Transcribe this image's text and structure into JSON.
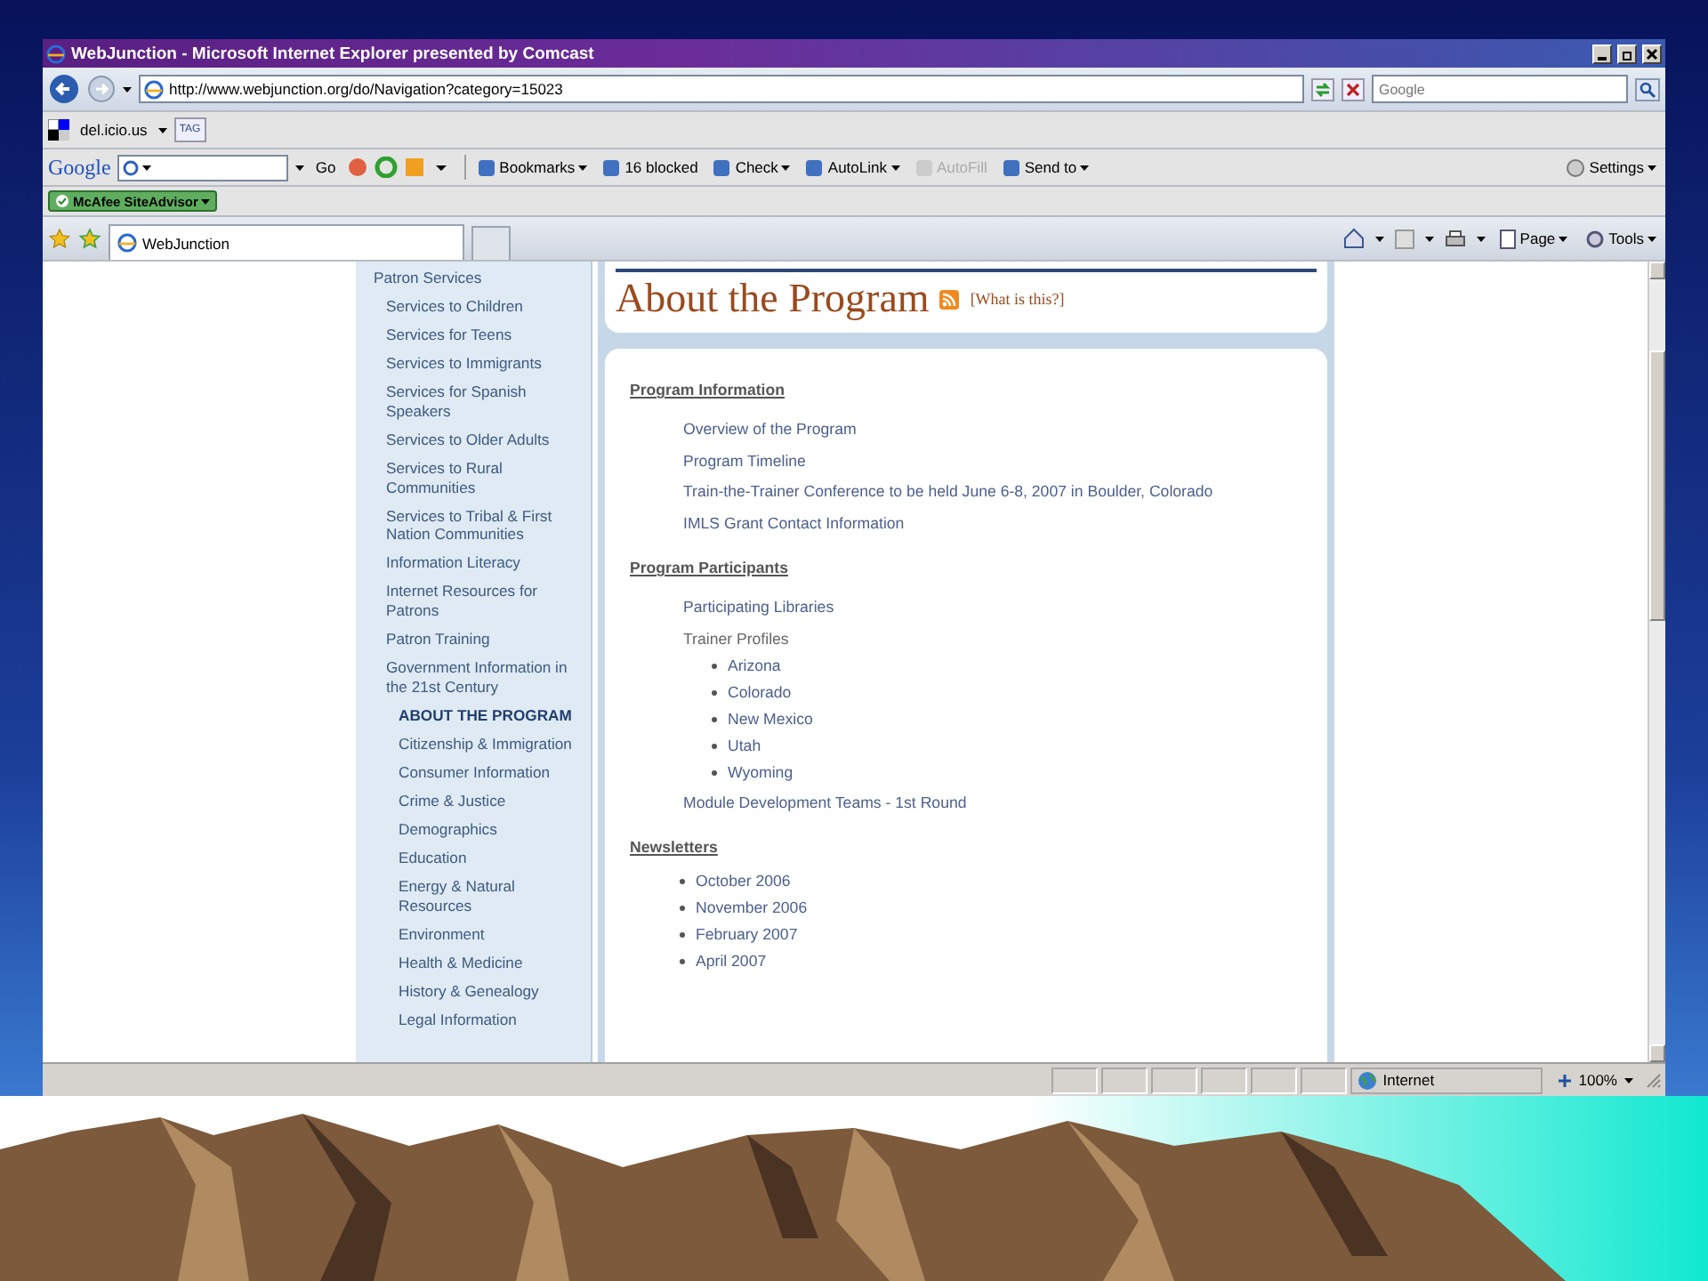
{
  "window": {
    "title": "WebJunction - Microsoft Internet Explorer presented by Comcast"
  },
  "address_bar": {
    "url": "http://www.webjunction.org/do/Navigation?category=15023",
    "search_placeholder": "Google"
  },
  "links_toolbar": {
    "link": "del.icio.us",
    "tag": "TAG"
  },
  "google_toolbar": {
    "logo": "Google",
    "go": "Go",
    "items": [
      {
        "label": "Bookmarks",
        "menu": true,
        "disabled": false
      },
      {
        "label": "16 blocked",
        "menu": false,
        "disabled": false
      },
      {
        "label": "Check",
        "menu": true,
        "disabled": false
      },
      {
        "label": "AutoLink",
        "menu": true,
        "disabled": false
      },
      {
        "label": "AutoFill",
        "menu": false,
        "disabled": true
      },
      {
        "label": "Send to",
        "menu": true,
        "disabled": false
      }
    ],
    "settings": "Settings"
  },
  "siteadvisor": {
    "label": "McAfee SiteAdvisor"
  },
  "tabs": [
    {
      "label": "WebJunction",
      "selected": true
    }
  ],
  "command_bar": {
    "page": "Page",
    "tools": "Tools"
  },
  "sidebar": {
    "items": [
      {
        "label": "Patron Services",
        "selected": false,
        "children": [
          {
            "label": "Services to Children",
            "selected": false
          },
          {
            "label": "Services for Teens",
            "selected": false
          },
          {
            "label": "Services to Immigrants",
            "selected": false
          },
          {
            "label": "Services for Spanish Speakers",
            "selected": false
          },
          {
            "label": "Services to Older Adults",
            "selected": false
          },
          {
            "label": "Services to Rural Communities",
            "selected": false
          },
          {
            "label": "Services to Tribal & First Nation Communities",
            "selected": false
          },
          {
            "label": "Information Literacy",
            "selected": false
          },
          {
            "label": "Internet Resources for Patrons",
            "selected": false
          },
          {
            "label": "Patron Training",
            "selected": false
          },
          {
            "label": "Government Information in the 21st Century",
            "selected": false,
            "children": [
              {
                "label": "ABOUT THE PROGRAM",
                "selected": true
              },
              {
                "label": "Citizenship & Immigration",
                "selected": false
              },
              {
                "label": "Consumer Information",
                "selected": false
              },
              {
                "label": "Crime & Justice",
                "selected": false
              },
              {
                "label": "Demographics",
                "selected": false
              },
              {
                "label": "Education",
                "selected": false
              },
              {
                "label": "Energy & Natural Resources",
                "selected": false
              },
              {
                "label": "Environment",
                "selected": false
              },
              {
                "label": "Health & Medicine",
                "selected": false
              },
              {
                "label": "History & Genealogy",
                "selected": false
              },
              {
                "label": "Legal Information",
                "selected": false
              }
            ]
          }
        ]
      }
    ]
  },
  "page": {
    "title": "About the Program",
    "feed_link": "[What is this?]",
    "sections": [
      {
        "heading": "Program Information",
        "items": [
          {
            "kind": "link",
            "text": "Overview of the Program"
          },
          {
            "kind": "link",
            "text": "Program Timeline"
          },
          {
            "kind": "link",
            "text": "Train-the-Trainer Conference to be held June 6-8, 2007 in Boulder, Colorado"
          },
          {
            "kind": "link",
            "text": "IMLS Grant Contact Information"
          }
        ]
      },
      {
        "heading": "Program Participants",
        "items": [
          {
            "kind": "link",
            "text": "Participating Libraries"
          },
          {
            "kind": "label",
            "text": "Trainer Profiles",
            "children": [
              "Arizona",
              "Colorado",
              "New Mexico",
              "Utah",
              "Wyoming"
            ]
          },
          {
            "kind": "link",
            "text": "Module Development Teams - 1st Round"
          }
        ]
      },
      {
        "heading": "Newsletters",
        "items": [
          {
            "kind": "bullet",
            "text": "October 2006"
          },
          {
            "kind": "bullet",
            "text": "November 2006"
          },
          {
            "kind": "bullet",
            "text": "February 2007"
          },
          {
            "kind": "bullet",
            "text": "April 2007"
          }
        ]
      }
    ]
  },
  "status_bar": {
    "zone": "Internet",
    "zoom": "100%"
  }
}
